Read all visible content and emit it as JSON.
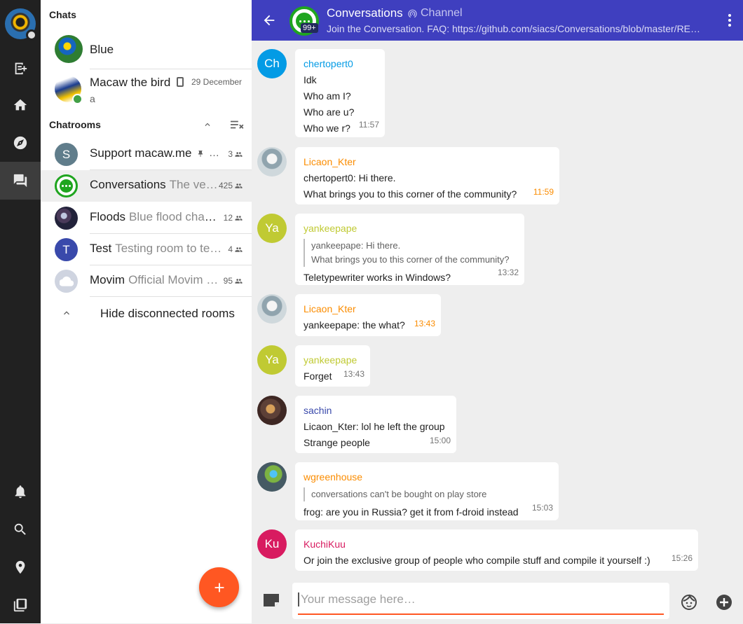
{
  "sidebar": {
    "sections": {
      "chats": "Chats",
      "chatrooms": "Chatrooms"
    },
    "contacts": [
      {
        "name": "Blue"
      },
      {
        "name": "Macaw the bird",
        "date": "29 December",
        "preview": "a"
      }
    ],
    "rooms": [
      {
        "initial": "S",
        "name": "Support macaw.me",
        "sub": "…",
        "count": "3",
        "color": "#607d8b"
      },
      {
        "initial": "",
        "name": "Conversations",
        "sub": "The ve…",
        "count": "425",
        "color": "#1fa51f"
      },
      {
        "initial": "",
        "name": "Floods",
        "sub": "Blue flood chan…",
        "count": "12",
        "color": "#3a3a5a"
      },
      {
        "initial": "T",
        "name": "Test",
        "sub": "Testing room to te…",
        "count": "4",
        "color": "#3949ab"
      },
      {
        "initial": "",
        "name": "Movim",
        "sub": "Official Movim …",
        "count": "95",
        "color": "#cfd4e0"
      }
    ],
    "hide_disconnected": "Hide disconnected rooms"
  },
  "header": {
    "title": "Conversations",
    "type": "Channel",
    "badge": "99+",
    "subject": "Join the Conversation. FAQ: https://github.com/siacs/Conversations/blob/master/README.md"
  },
  "messages": [
    {
      "author": "chertopert0",
      "initials": "Ch",
      "author_color": "#039be5",
      "avatar_color": "#039be5",
      "lines": [
        "Idk",
        "Who am I?",
        "Who are u?",
        "Who we r?"
      ],
      "time": "11:57"
    },
    {
      "author": "Licaon_Kter",
      "initials": "",
      "author_color": "#fb8c00",
      "avatar_color": "#cfd8dc",
      "lines": [
        "chertopert0: Hi there.",
        "What brings you to this corner of the community?"
      ],
      "time": "11:59",
      "time_color": "#fb8c00"
    },
    {
      "author": "yankeepape",
      "initials": "Ya",
      "author_color": "#c0ca33",
      "avatar_color": "#c0ca33",
      "quote": [
        "yankeepape: Hi there.",
        "What brings you to this corner of the community?"
      ],
      "lines": [
        "Teletypewriter works in Windows?"
      ],
      "time": "13:32"
    },
    {
      "author": "Licaon_Kter",
      "initials": "",
      "author_color": "#fb8c00",
      "avatar_color": "#cfd8dc",
      "lines": [
        "yankeepape: the what?"
      ],
      "time": "13:43",
      "time_color": "#fb8c00"
    },
    {
      "author": "yankeepape",
      "initials": "Ya",
      "author_color": "#c0ca33",
      "avatar_color": "#c0ca33",
      "lines": [
        "Forget"
      ],
      "time": "13:43"
    },
    {
      "author": "sachin",
      "initials": "",
      "author_color": "#3949ab",
      "avatar_color": "#5d4037",
      "lines": [
        "Licaon_Kter: lol he left the group",
        "Strange people"
      ],
      "time": "15:00"
    },
    {
      "author": "wgreenhouse",
      "initials": "",
      "author_color": "#fb8c00",
      "avatar_color": "#546e7a",
      "quote": [
        "conversations can't be bought on play store"
      ],
      "lines": [
        "frog: are you in Russia? get it from f-droid instead"
      ],
      "time": "15:03"
    },
    {
      "author": "KuchiKuu",
      "initials": "Ku",
      "author_color": "#d81b60",
      "avatar_color": "#d81b60",
      "lines": [
        "Or join the exclusive group of people who compile stuff and compile it yourself :)"
      ],
      "time": "15:26"
    }
  ],
  "composer": {
    "placeholder": "Your message here…"
  },
  "colors": {
    "header_bg": "#3f3fbf",
    "accent": "#ff5722",
    "nav_bg": "#212121"
  }
}
